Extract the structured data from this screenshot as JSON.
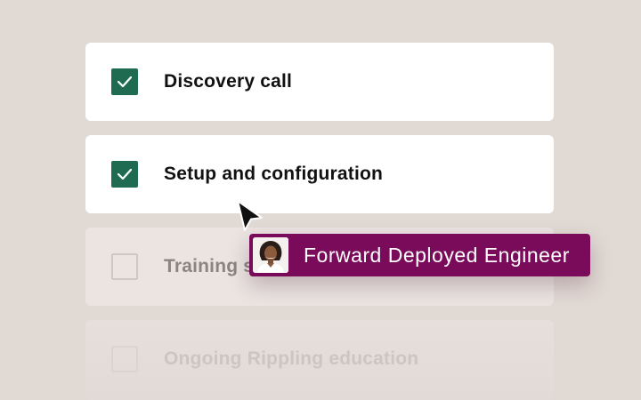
{
  "checklist": {
    "items": [
      {
        "label": "Discovery call",
        "checked": true
      },
      {
        "label": "Setup and configuration",
        "checked": true
      },
      {
        "label": "Training s",
        "checked": false
      },
      {
        "label": "Ongoing Rippling education",
        "checked": false
      }
    ]
  },
  "assignee_tag": {
    "label": "Forward Deployed Engineer",
    "icon": "avatar-photo"
  },
  "colors": {
    "background": "#e1d9d4",
    "checkbox_checked": "#1f6b52",
    "tag_background": "#7a0a5a"
  }
}
